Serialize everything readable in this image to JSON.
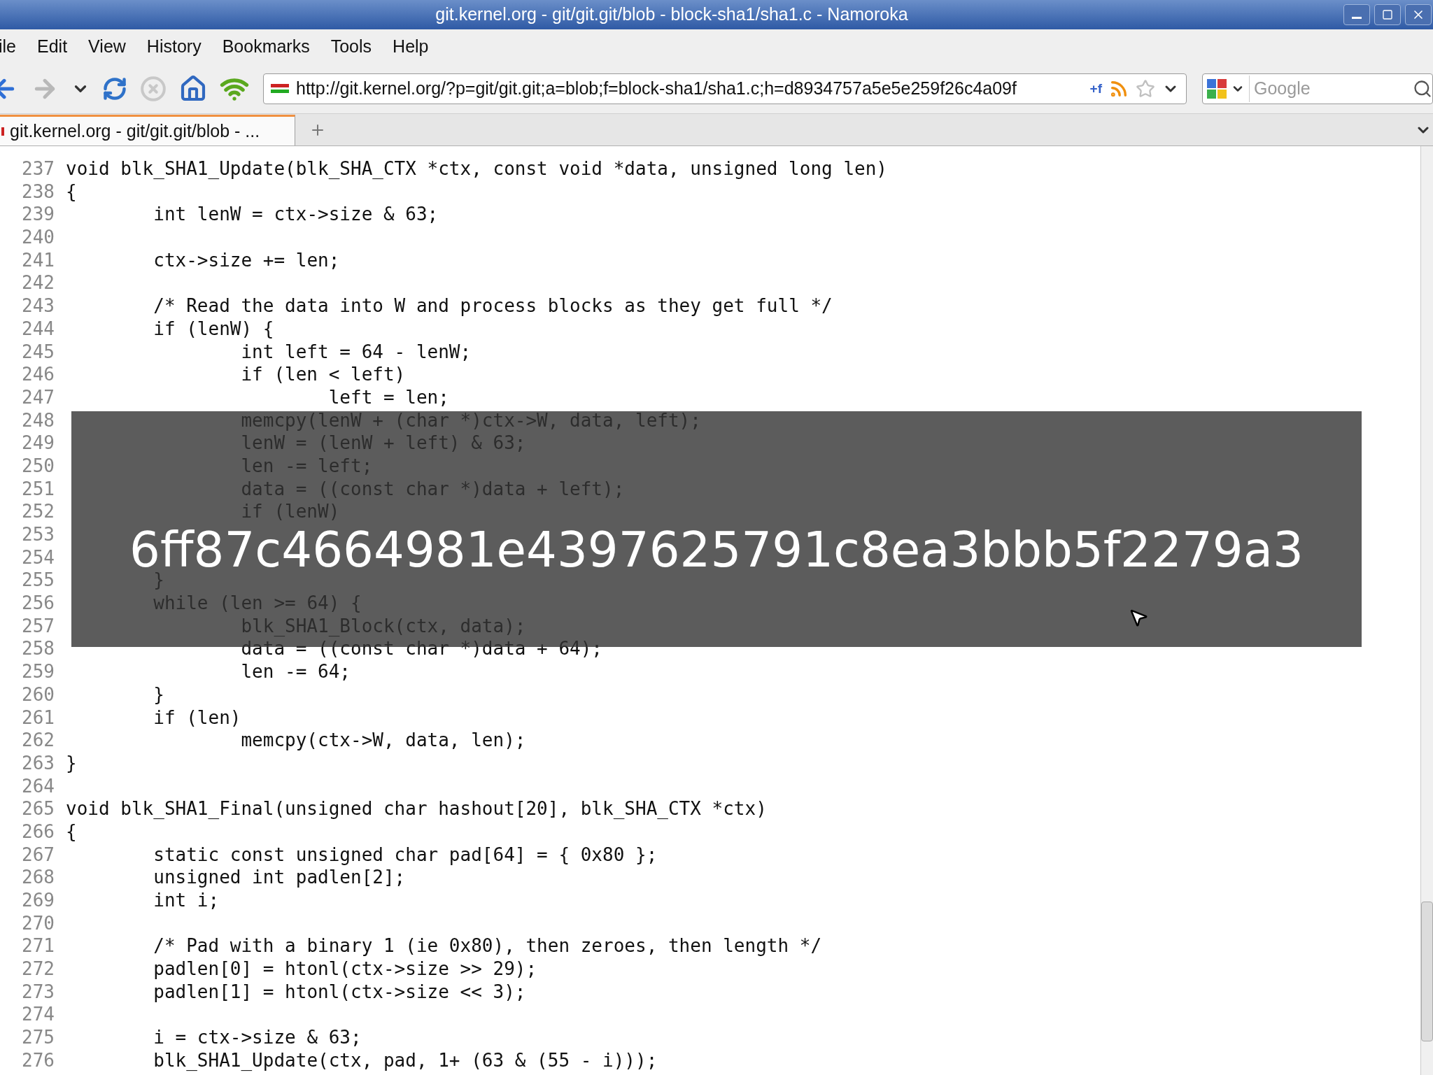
{
  "window": {
    "title": "git.kernel.org - git/git.git/blob - block-sha1/sha1.c - Namoroka"
  },
  "menu": [
    "ile",
    "Edit",
    "View",
    "History",
    "Bookmarks",
    "Tools",
    "Help"
  ],
  "address_bar": {
    "value": "http://git.kernel.org/?p=git/git.git;a=blob;f=block-sha1/sha1.c;h=d8934757a5e5e259f26c4a09f",
    "extra": "+f"
  },
  "search": {
    "placeholder": "Google"
  },
  "tabs": [
    {
      "label": "git.kernel.org - git/git.git/blob - ...",
      "selected": true
    }
  ],
  "code_lines": [
    {
      "number": "237",
      "text": "void blk_SHA1_Update(blk_SHA_CTX *ctx, const void *data, unsigned long len)"
    },
    {
      "number": "238",
      "text": "{"
    },
    {
      "number": "239",
      "text": "\tint lenW = ctx->size & 63;"
    },
    {
      "number": "240"
    },
    {
      "number": "241",
      "text": "\tctx->size += len;"
    },
    {
      "number": "242"
    },
    {
      "number": "243",
      "text": "\t/* Read the data into W and process blocks as they get full */"
    },
    {
      "number": "244",
      "text": "\tif (lenW) {"
    },
    {
      "number": "245",
      "text": "\t\tint left = 64 - lenW;"
    },
    {
      "number": "246",
      "text": "\t\tif (len < left)"
    },
    {
      "number": "247",
      "text": "\t\t\tleft = len;"
    },
    {
      "number": "248",
      "text": "\t\tmemcpy(lenW + (char *)ctx->W, data, left);"
    },
    {
      "number": "249",
      "text": "\t\tlenW = (lenW + left) & 63;"
    },
    {
      "number": "250",
      "text": "\t\tlen -= left;"
    },
    {
      "number": "251",
      "text": "\t\tdata = ((const char *)data + left);"
    },
    {
      "number": "252",
      "text": "\t\tif (lenW)"
    },
    {
      "number": "253"
    },
    {
      "number": "254"
    },
    {
      "number": "255",
      "text": "\t}"
    },
    {
      "number": "256",
      "text": "\twhile (len >= 64) {"
    },
    {
      "number": "257",
      "text": "\t\tblk_SHA1_Block(ctx, data);"
    },
    {
      "number": "258",
      "text": "\t\tdata = ((const char *)data + 64);"
    },
    {
      "number": "259",
      "text": "\t\tlen -= 64;"
    },
    {
      "number": "260",
      "text": "\t}"
    },
    {
      "number": "261",
      "text": "\tif (len)"
    },
    {
      "number": "262",
      "text": "\t\tmemcpy(ctx->W, data, len);"
    },
    {
      "number": "263",
      "text": "}"
    },
    {
      "number": "264"
    },
    {
      "number": "265",
      "text": "void blk_SHA1_Final(unsigned char hashout[20], blk_SHA_CTX *ctx)"
    },
    {
      "number": "266",
      "text": "{"
    },
    {
      "number": "267",
      "text": "\tstatic const unsigned char pad[64] = { 0x80 };"
    },
    {
      "number": "268",
      "text": "\tunsigned int padlen[2];"
    },
    {
      "number": "269",
      "text": "\tint i;"
    },
    {
      "number": "270"
    },
    {
      "number": "271",
      "text": "\t/* Pad with a binary 1 (ie 0x80), then zeroes, then length */"
    },
    {
      "number": "272",
      "text": "\tpadlen[0] = htonl(ctx->size >> 29);"
    },
    {
      "number": "273",
      "text": "\tpadlen[1] = htonl(ctx->size << 3);"
    },
    {
      "number": "274"
    },
    {
      "number": "275",
      "text": "\ti = ctx->size & 63;"
    },
    {
      "number": "276",
      "text": "\tblk_SHA1_Update(ctx, pad, 1+ (63 & (55 - i)));"
    }
  ],
  "overlay": {
    "text": "6ff87c4664981e4397625791c8ea3bbb5f2279a3"
  }
}
